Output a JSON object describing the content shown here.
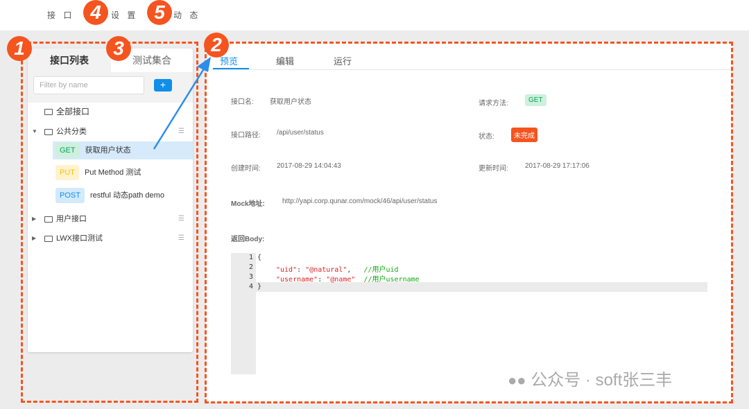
{
  "topnav": {
    "items": [
      "接 口",
      "设 置",
      "动 态"
    ]
  },
  "annotations": [
    "1",
    "2",
    "3",
    "4",
    "5"
  ],
  "sidebar": {
    "tabs": [
      "接口列表",
      "测试集合"
    ],
    "filter_placeholder": "Filter by name",
    "add_label": "+",
    "all_label": "全部接口",
    "groups": [
      {
        "name": "公共分类",
        "expanded": true,
        "items": [
          {
            "method": "GET",
            "name": "获取用户状态",
            "selected": true
          },
          {
            "method": "PUT",
            "name": "Put Method 测试"
          },
          {
            "method": "POST",
            "name": "restful 动态path demo"
          }
        ]
      },
      {
        "name": "用户接口",
        "expanded": false
      },
      {
        "name": "LWX接口测试",
        "expanded": false
      }
    ]
  },
  "main": {
    "tabs": [
      "预览",
      "编辑",
      "运行"
    ],
    "active_tab": "预览",
    "fields": {
      "name_label": "接口名:",
      "name": "获取用户状态",
      "method_label": "请求方法:",
      "method": "GET",
      "path_label": "接口路径:",
      "path": "/api/user/status",
      "status_label": "状态:",
      "status": "未完成",
      "created_label": "创建时间:",
      "created": "2017-08-29 14:04:43",
      "updated_label": "更新时间:",
      "updated": "2017-08-29 17:17:06",
      "mock_label": "Mock地址:",
      "mock": "http://yapi.corp.qunar.com/mock/46/api/user/status",
      "body_label": "返回Body:"
    },
    "code": {
      "lines": [
        "1",
        "2",
        "3",
        "4"
      ],
      "open": "{",
      "close": "}",
      "l2_key": "\"uid\"",
      "l2_val": "\"@natural\"",
      "l2_comment": "//用户uid",
      "l3_key": "\"username\"",
      "l3_val": "\"@name\"",
      "l3_comment": "//用户username"
    }
  },
  "watermark": "公众号 · soft张三丰",
  "colors": {
    "accent": "#108ee9",
    "annotation": "#f5541f",
    "get": "#00a854",
    "put": "#ffbf00",
    "post": "#108ee9"
  }
}
